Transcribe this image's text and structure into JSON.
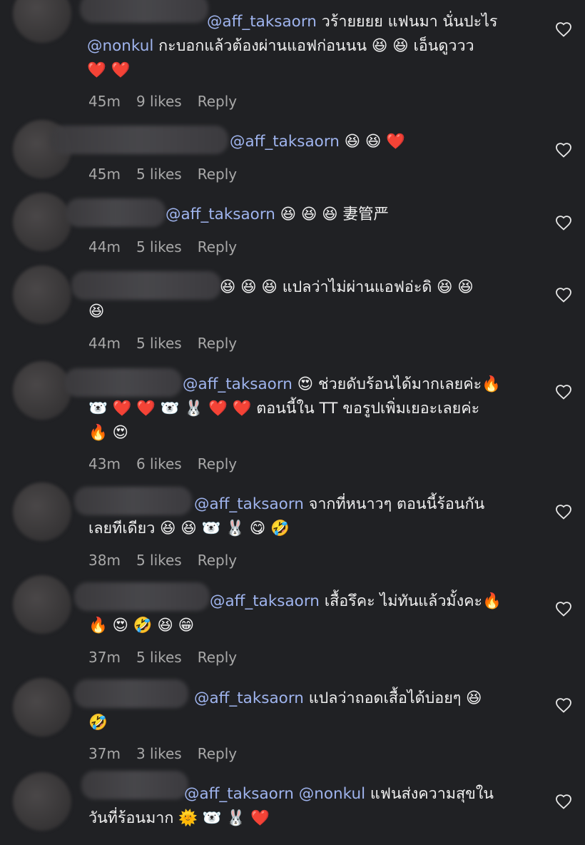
{
  "comments": [
    {
      "lines": [
        [
          {
            "t": "@aff_taksaorn",
            "m": true
          },
          {
            "t": " วร้ายยยย แฟนมา นั่นปะไร"
          }
        ],
        [
          {
            "t": "@nonkul",
            "m": true
          },
          {
            "t": " กะบอกแล้วต้องผ่านแอฟก่อนนน 😆 😆 เอ็นดูววว"
          }
        ],
        [
          {
            "t": "❤️ ❤️"
          }
        ]
      ],
      "time": "45m",
      "likes": "9 likes",
      "reply": "Reply"
    },
    {
      "lines": [
        [
          {
            "t": "@aff_taksaorn",
            "m": true
          },
          {
            "t": " 😆 😆 ❤️"
          }
        ]
      ],
      "time": "45m",
      "likes": "5 likes",
      "reply": "Reply"
    },
    {
      "lines": [
        [
          {
            "t": "@aff_taksaorn",
            "m": true
          },
          {
            "t": " 😆 😆 😆 妻管严"
          }
        ]
      ],
      "time": "44m",
      "likes": "5 likes",
      "reply": "Reply"
    },
    {
      "lines": [
        [
          {
            "t": "😆 😆 😆 แปลว่าไม่ผ่านแอฟอ่ะดิ 😆 😆"
          }
        ],
        [
          {
            "t": "😆"
          }
        ]
      ],
      "time": "44m",
      "likes": "5 likes",
      "reply": "Reply"
    },
    {
      "lines": [
        [
          {
            "t": "@aff_taksaorn",
            "m": true
          },
          {
            "t": " 😍 ช่วยดับร้อนได้มากเลยค่ะ🔥"
          }
        ],
        [
          {
            "t": "🐻‍❄️ ❤️ ❤️ 🐻‍❄️ 🐰 ❤️ ❤️ ตอนนี้ใน TT ขอรูปเพิ่มเยอะเลยค่ะ"
          }
        ],
        [
          {
            "t": "🔥 😍"
          }
        ]
      ],
      "time": "43m",
      "likes": "6 likes",
      "reply": "Reply"
    },
    {
      "lines": [
        [
          {
            "t": "@aff_taksaorn",
            "m": true
          },
          {
            "t": " จากที่หนาวๆ ตอนนี้ร้อนกัน"
          }
        ],
        [
          {
            "t": "เลยทีเดียว 😆 😆 🐻‍❄️ 🐰 😋 🤣"
          }
        ]
      ],
      "time": "38m",
      "likes": "5 likes",
      "reply": "Reply"
    },
    {
      "lines": [
        [
          {
            "t": "@aff_taksaorn",
            "m": true
          },
          {
            "t": " เสื้อรึคะ ไม่ทันแล้วมั้งคะ🔥"
          }
        ],
        [
          {
            "t": "🔥 😍 🤣 😆 😁"
          }
        ]
      ],
      "time": "37m",
      "likes": "5 likes",
      "reply": "Reply"
    },
    {
      "lines": [
        [
          {
            "t": "@aff_taksaorn",
            "m": true
          },
          {
            "t": " แปลว่าถอดเสื้อได้บ่อยๆ 😆"
          }
        ],
        [
          {
            "t": "🤣"
          }
        ]
      ],
      "time": "37m",
      "likes": "3 likes",
      "reply": "Reply"
    },
    {
      "lines": [
        [
          {
            "t": "@aff_taksaorn",
            "m": true
          },
          {
            "t": " "
          },
          {
            "t": "@nonkul",
            "m": true
          },
          {
            "t": " แฟนส่งความสุขใน"
          }
        ],
        [
          {
            "t": "วันที่ร้อนมาก 🌞 🐻‍❄️ 🐰 ❤️"
          }
        ]
      ],
      "time": "",
      "likes": "",
      "reply": ""
    }
  ]
}
